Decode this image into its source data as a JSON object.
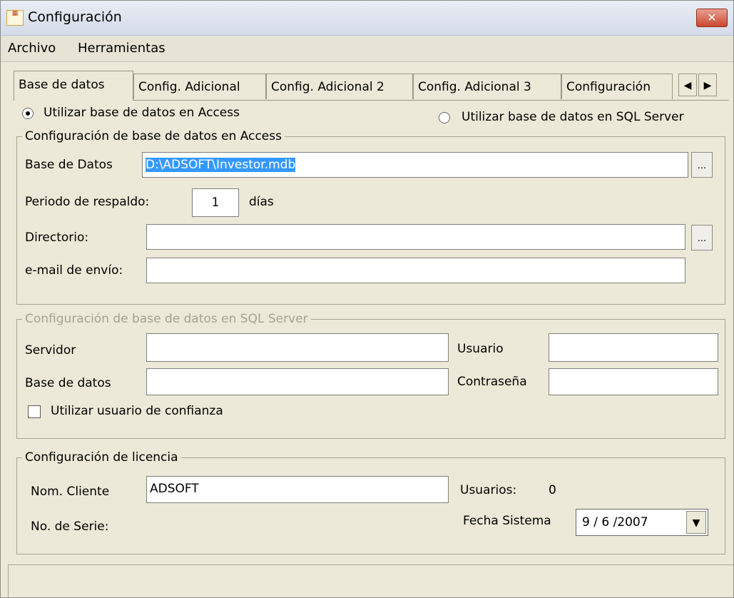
{
  "window": {
    "title": "Configuración",
    "close_label": "✕"
  },
  "menu": {
    "archivo": "Archivo",
    "herramientas": "Herramientas"
  },
  "tabs": [
    {
      "label": "Base de datos"
    },
    {
      "label": "Config. Adicional"
    },
    {
      "label": "Config. Adicional 2"
    },
    {
      "label": "Config. Adicional 3"
    },
    {
      "label": "Configuración"
    }
  ],
  "tab_scroll": {
    "left": "◀",
    "right": "▶"
  },
  "db_mode": {
    "access_label": "Utilizar base de datos en Access",
    "sql_label": "Utilizar base de datos en SQL Server",
    "selected": "access"
  },
  "access_group": {
    "legend": "Configuración de base de datos en Access",
    "db_label": "Base de Datos",
    "db_value": "D:\\ADSOFT\\Investor.mdb",
    "browse_label": "...",
    "backup_label": "Periodo de respaldo:",
    "backup_value": "1",
    "backup_unit": "días",
    "dir_label": "Directorio:",
    "dir_value": "",
    "email_label": "e-mail de envío:",
    "email_value": ""
  },
  "sql_group": {
    "legend": "Configuración de base de datos en SQL Server",
    "server_label": "Servidor",
    "server_value": "",
    "user_label": "Usuario",
    "user_value": "",
    "database_label": "Base de datos",
    "database_value": "",
    "password_label": "Contraseña",
    "password_value": "",
    "trusted_label": "Utilizar usuario de confianza",
    "trusted_checked": false
  },
  "license_group": {
    "legend": "Configuración de licencia",
    "client_label": "Nom. Cliente",
    "client_value": "ADSOFT",
    "users_label": "Usuarios:",
    "users_value": "0",
    "serial_label": "No. de Serie:",
    "date_label": "Fecha Sistema",
    "date_value": "9 / 6 /2007"
  },
  "colors": {
    "selection": "#3399ff",
    "window_bg": "#ece9d8",
    "close_button": "#c9472f"
  }
}
